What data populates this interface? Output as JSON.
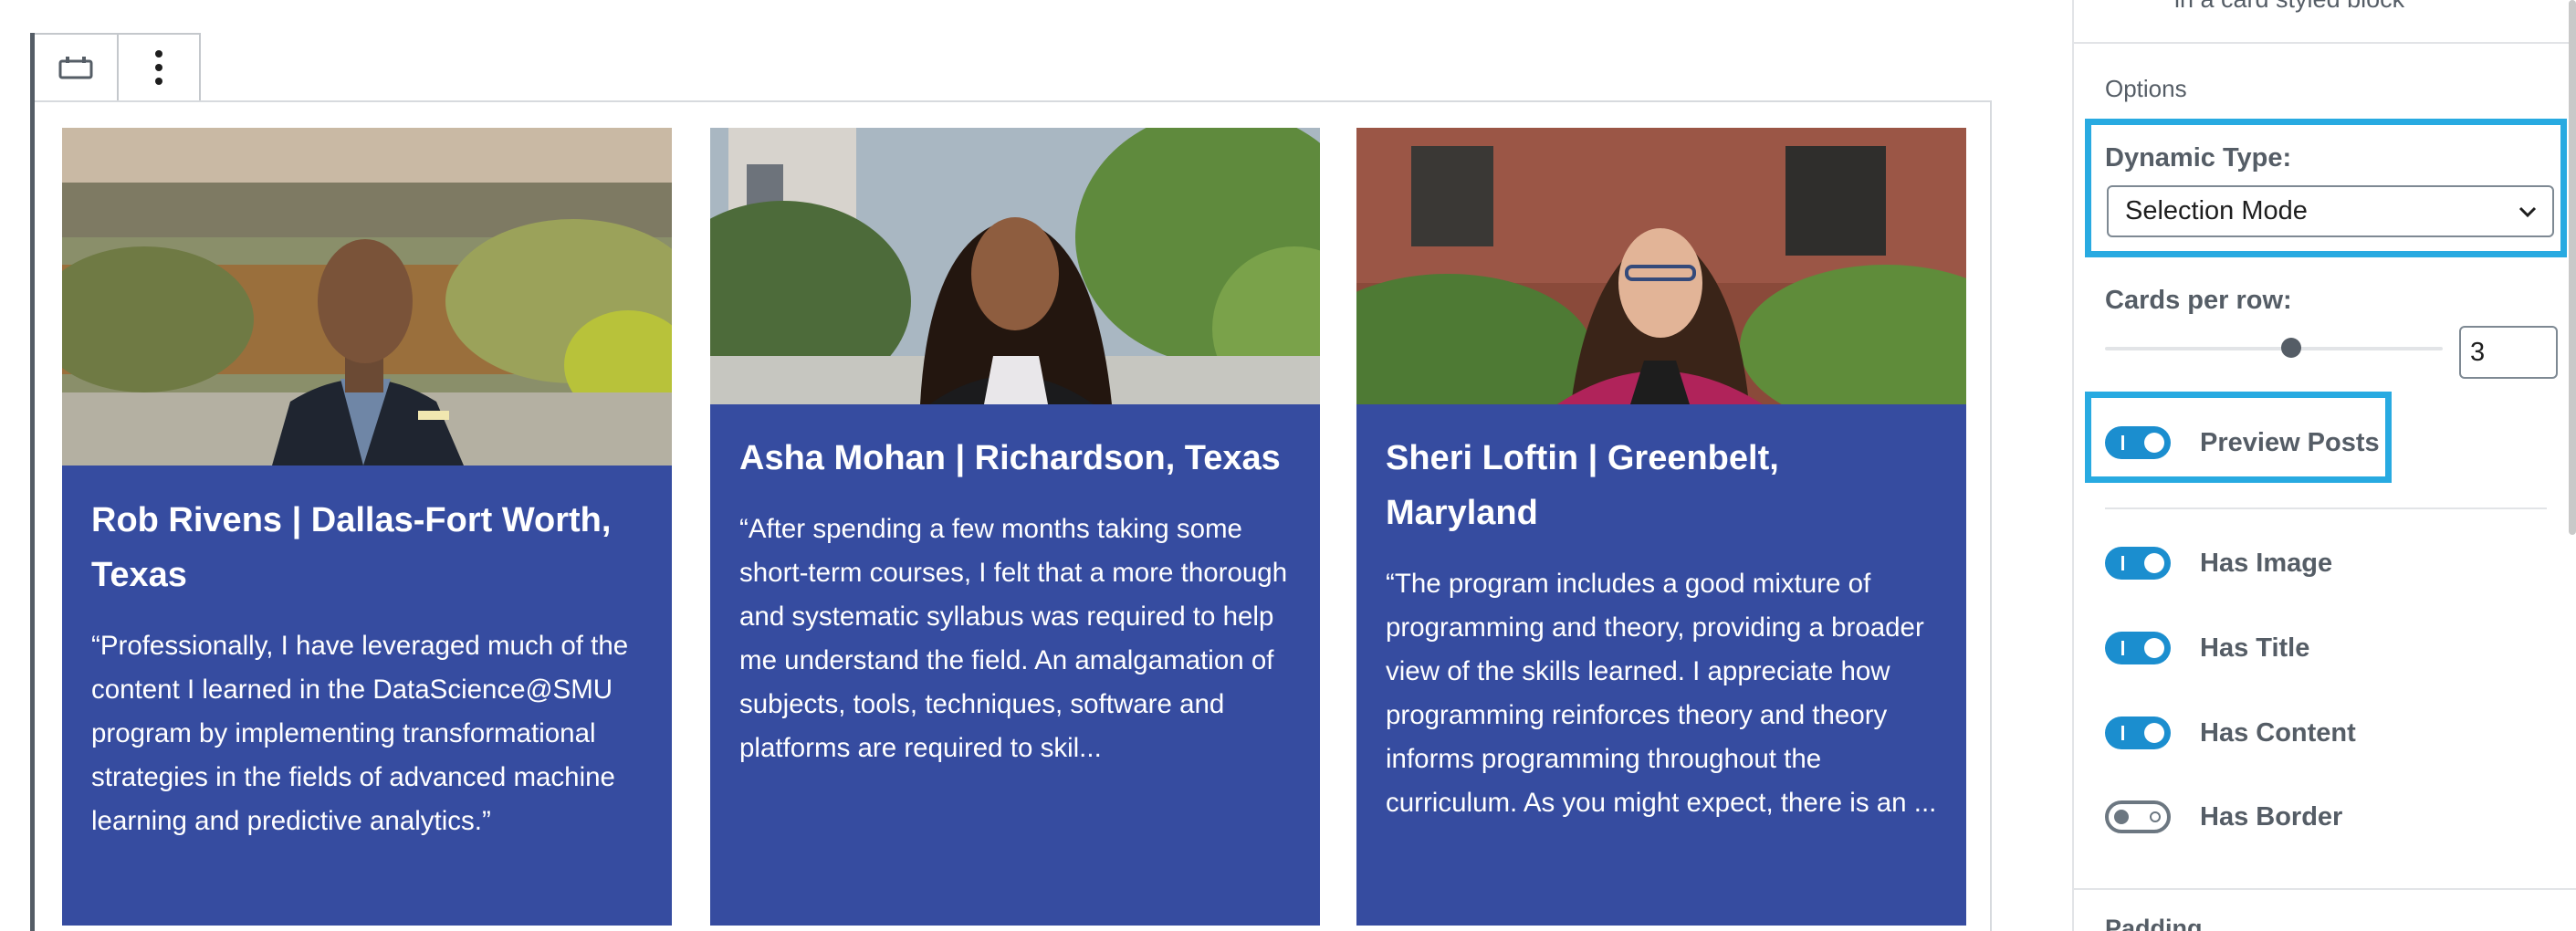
{
  "toolbar": {
    "block_icon": "block-type-icon",
    "more_icon": "more-options-icon"
  },
  "cards": [
    {
      "title": "Rob Rivens | Dallas-Fort Worth, Texas",
      "text": "“Professionally, I have leveraged much of the content I learned in the DataScience@SMU program by implementing transformational strategies in the fields of advanced machine learning and predictive analytics.”",
      "photo": "portrait-rob-rivens"
    },
    {
      "title": "Asha Mohan | Richardson, Texas",
      "text": "“After spending a few months taking some short-term courses, I felt that a more thorough and systematic syllabus was required to help me understand the field. An amalgamation of subjects, tools, techniques, software and platforms are required to skil...",
      "photo": "portrait-asha-mohan"
    },
    {
      "title": "Sheri Loftin | Greenbelt, Maryland",
      "text": "“The program includes a good mixture of programming and theory, providing a broader view of the skills learned. I appreciate how programming reinforces theory and theory informs programming throughout the curriculum. As you might expect, there is an ...",
      "photo": "portrait-sheri-loftin"
    }
  ],
  "sidebar": {
    "top_text": "in a card styled block",
    "options_heading": "Options",
    "dynamic_type": {
      "label": "Dynamic Type:",
      "value": "Selection Mode"
    },
    "cards_per_row": {
      "label": "Cards per row:",
      "value": "3",
      "slider_fraction": 0.55
    },
    "toggles": [
      {
        "label": "Preview Posts",
        "on": true
      },
      {
        "label": "Has Image",
        "on": true
      },
      {
        "label": "Has Title",
        "on": true
      },
      {
        "label": "Has Content",
        "on": true
      },
      {
        "label": "Has Border",
        "on": false
      }
    ],
    "bottom_heading": "Padding"
  },
  "colors": {
    "card_bg": "#364ca0",
    "highlight": "#28aae1",
    "toggle_on": "#1b8ecf"
  }
}
